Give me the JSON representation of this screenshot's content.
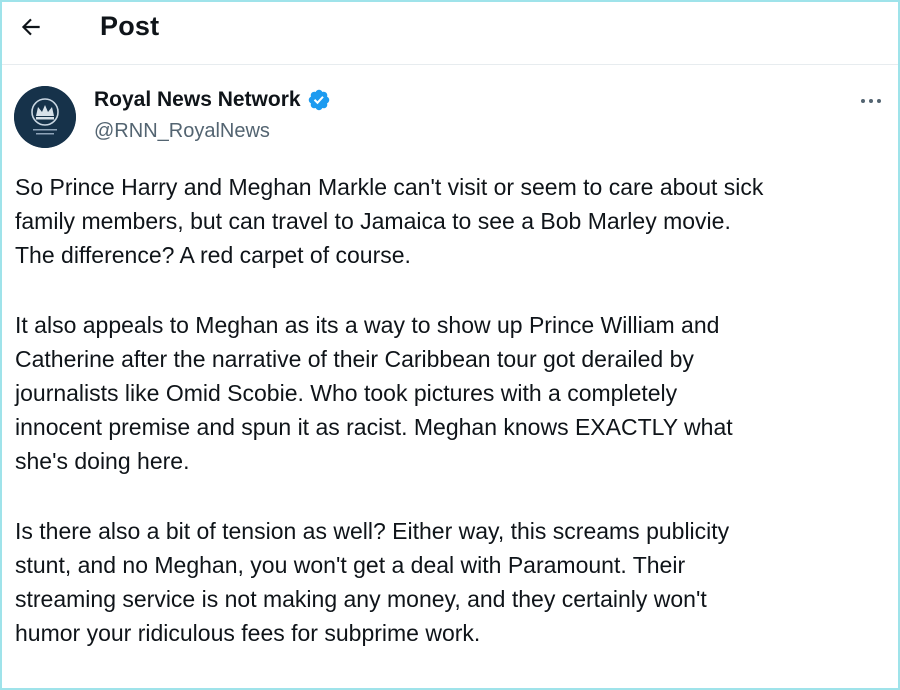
{
  "header": {
    "back_icon": "arrow-left-icon",
    "title": "Post"
  },
  "post": {
    "author": {
      "display_name": "Royal News Network",
      "handle": "@RNN_RoyalNews",
      "verified": true,
      "verified_icon": "verified-badge-icon",
      "avatar_icon": "crown-emblem-icon"
    },
    "more_icon": "more-horizontal-icon",
    "paragraphs": [
      "So Prince Harry and Meghan Markle can't visit or seem to care about sick\nfamily members, but can travel to Jamaica to see a Bob Marley movie.\nThe difference? A red carpet of course.",
      "It also appeals to Meghan as its a way to show up Prince William and\nCatherine after the narrative of their Caribbean tour got derailed by\njournalists like Omid Scobie. Who took pictures with a completely\ninnocent premise and spun it as racist. Meghan knows EXACTLY what\nshe's doing here.",
      "Is there also a bit of tension as well? Either way, this screams publicity\nstunt, and no Meghan, you won't get a deal with Paramount. Their\nstreaming service is not making any money, and they certainly won't\nhumor your ridiculous fees for subprime work."
    ]
  },
  "colors": {
    "text": "#0f1419",
    "secondary_text": "#536471",
    "verified_blue": "#1d9bf0",
    "avatar_bg": "#16324a",
    "frame_border": "#9fe3ea"
  }
}
